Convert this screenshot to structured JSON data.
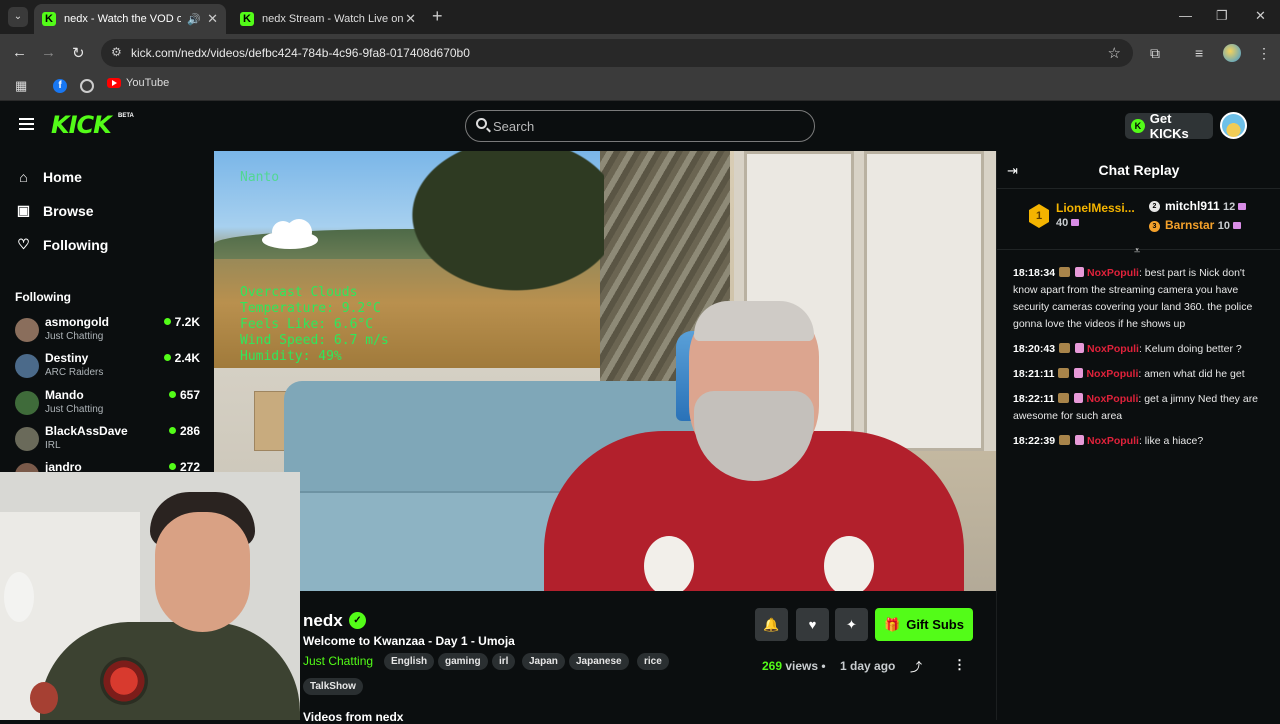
{
  "browser": {
    "tabs": [
      {
        "title": "nedx - Watch the VOD on Kick",
        "active": true,
        "audio": true
      },
      {
        "title": "nedx Stream - Watch Live on Kick",
        "active": false,
        "audio": false
      }
    ],
    "url": "kick.com/nedx/videos/defbc424-784b-4c96-9fa8-017408d670b0",
    "bookmarks": [
      {
        "icon": "facebook-icon",
        "label": ""
      },
      {
        "icon": "globe-icon",
        "label": ""
      },
      {
        "icon": "youtube-icon",
        "label": "YouTube"
      }
    ]
  },
  "header": {
    "logo": "KICK",
    "logo_badge": "BETA",
    "search_placeholder": "Search",
    "get_kicks": "Get KICKs"
  },
  "sidebar": {
    "nav": [
      {
        "label": "Home",
        "icon": "home-icon"
      },
      {
        "label": "Browse",
        "icon": "browse-icon"
      },
      {
        "label": "Following",
        "icon": "heart-icon"
      }
    ],
    "following_heading": "Following",
    "channels": [
      {
        "name": "asmongold",
        "category": "Just Chatting",
        "viewers": "7.2K",
        "color": "#8a6e5c"
      },
      {
        "name": "Destiny",
        "category": "ARC Raiders",
        "viewers": "2.4K",
        "color": "#4b6a8a"
      },
      {
        "name": "Mando",
        "category": "Just Chatting",
        "viewers": "657",
        "color": "#3f6b3a"
      },
      {
        "name": "BlackAssDave",
        "category": "IRL",
        "viewers": "286",
        "color": "#6a6a5a"
      },
      {
        "name": "jandro",
        "category": "",
        "viewers": "272",
        "color": "#7a5a4a"
      }
    ]
  },
  "video": {
    "weather_overlay": {
      "location": "Nanto",
      "lines": [
        "Overcast Clouds",
        "Temperature: 9.2°C",
        "Feels Like: 6.6°C",
        "Wind Speed: 6.7 m/s",
        "Humidity: 49%"
      ]
    }
  },
  "stream": {
    "streamer": "nedx",
    "title": "Welcome to Kwanzaa - Day 1 - Umoja",
    "category": "Just Chatting",
    "tags": [
      "English",
      "gaming",
      "irl",
      "Japan",
      "Japanese",
      "rice",
      "TalkShow"
    ],
    "gift_label": "Gift Subs",
    "views_count": "269",
    "views_label": "views",
    "separator": "•",
    "posted": "1 day ago",
    "section_heading": "Videos from nedx"
  },
  "chat": {
    "title": "Chat Replay",
    "leaderboard": [
      {
        "rank": "1",
        "name": "LionelMessi...",
        "points": "40",
        "color": "#f4b400"
      },
      {
        "rank": "2",
        "name": "mitchl911",
        "points": "12",
        "color": "#ffffff"
      },
      {
        "rank": "3",
        "name": "Barnstar",
        "points": "10",
        "color": "#f4a12b"
      }
    ],
    "messages": [
      {
        "time": "18:18:34",
        "user": "NoxPopuli",
        "text": "best part is Nick don't know apart from the streaming camera you have security cameras covering your land 360. the police gonna love the videos if he shows up"
      },
      {
        "time": "18:20:43",
        "user": "NoxPopuli",
        "text": "Kelum doing better ?"
      },
      {
        "time": "18:21:11",
        "user": "NoxPopuli",
        "text": "amen what did he get"
      },
      {
        "time": "18:22:11",
        "user": "NoxPopuli",
        "text": "get a jimny Ned they are awesome for such area"
      },
      {
        "time": "18:22:39",
        "user": "NoxPopuli",
        "text": "like a hiace?"
      }
    ]
  }
}
